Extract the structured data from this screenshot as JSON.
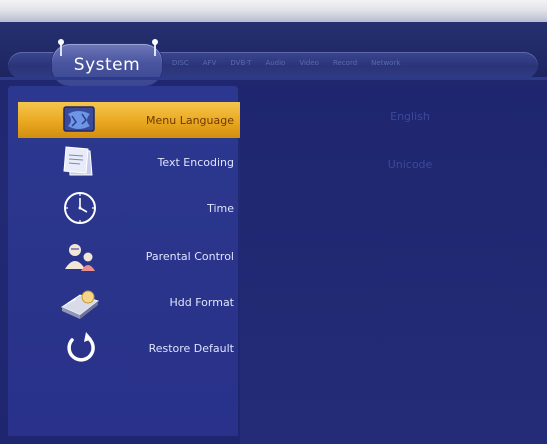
{
  "header": {
    "active_tab": "System",
    "tabs": [
      "DISC",
      "AFV",
      "DVB-T",
      "Audio",
      "Video",
      "Record",
      "Network"
    ]
  },
  "sidebar": {
    "items": [
      {
        "label": "Menu Language",
        "icon": "globe-monitor-icon",
        "selected": true
      },
      {
        "label": "Text Encoding",
        "icon": "document-pages-icon",
        "selected": false
      },
      {
        "label": "Time",
        "icon": "clock-icon",
        "selected": false
      },
      {
        "label": "Parental Control",
        "icon": "parent-child-icon",
        "selected": false
      },
      {
        "label": "Hdd Format",
        "icon": "hdd-format-icon",
        "selected": false
      },
      {
        "label": "Restore Default",
        "icon": "restore-arrow-icon",
        "selected": false
      }
    ]
  },
  "content": {
    "values": [
      "English",
      "Unicode"
    ]
  },
  "colors": {
    "selected_highlight": "#eaa820",
    "background": "#20276e",
    "sidebar": "#2c3890"
  }
}
